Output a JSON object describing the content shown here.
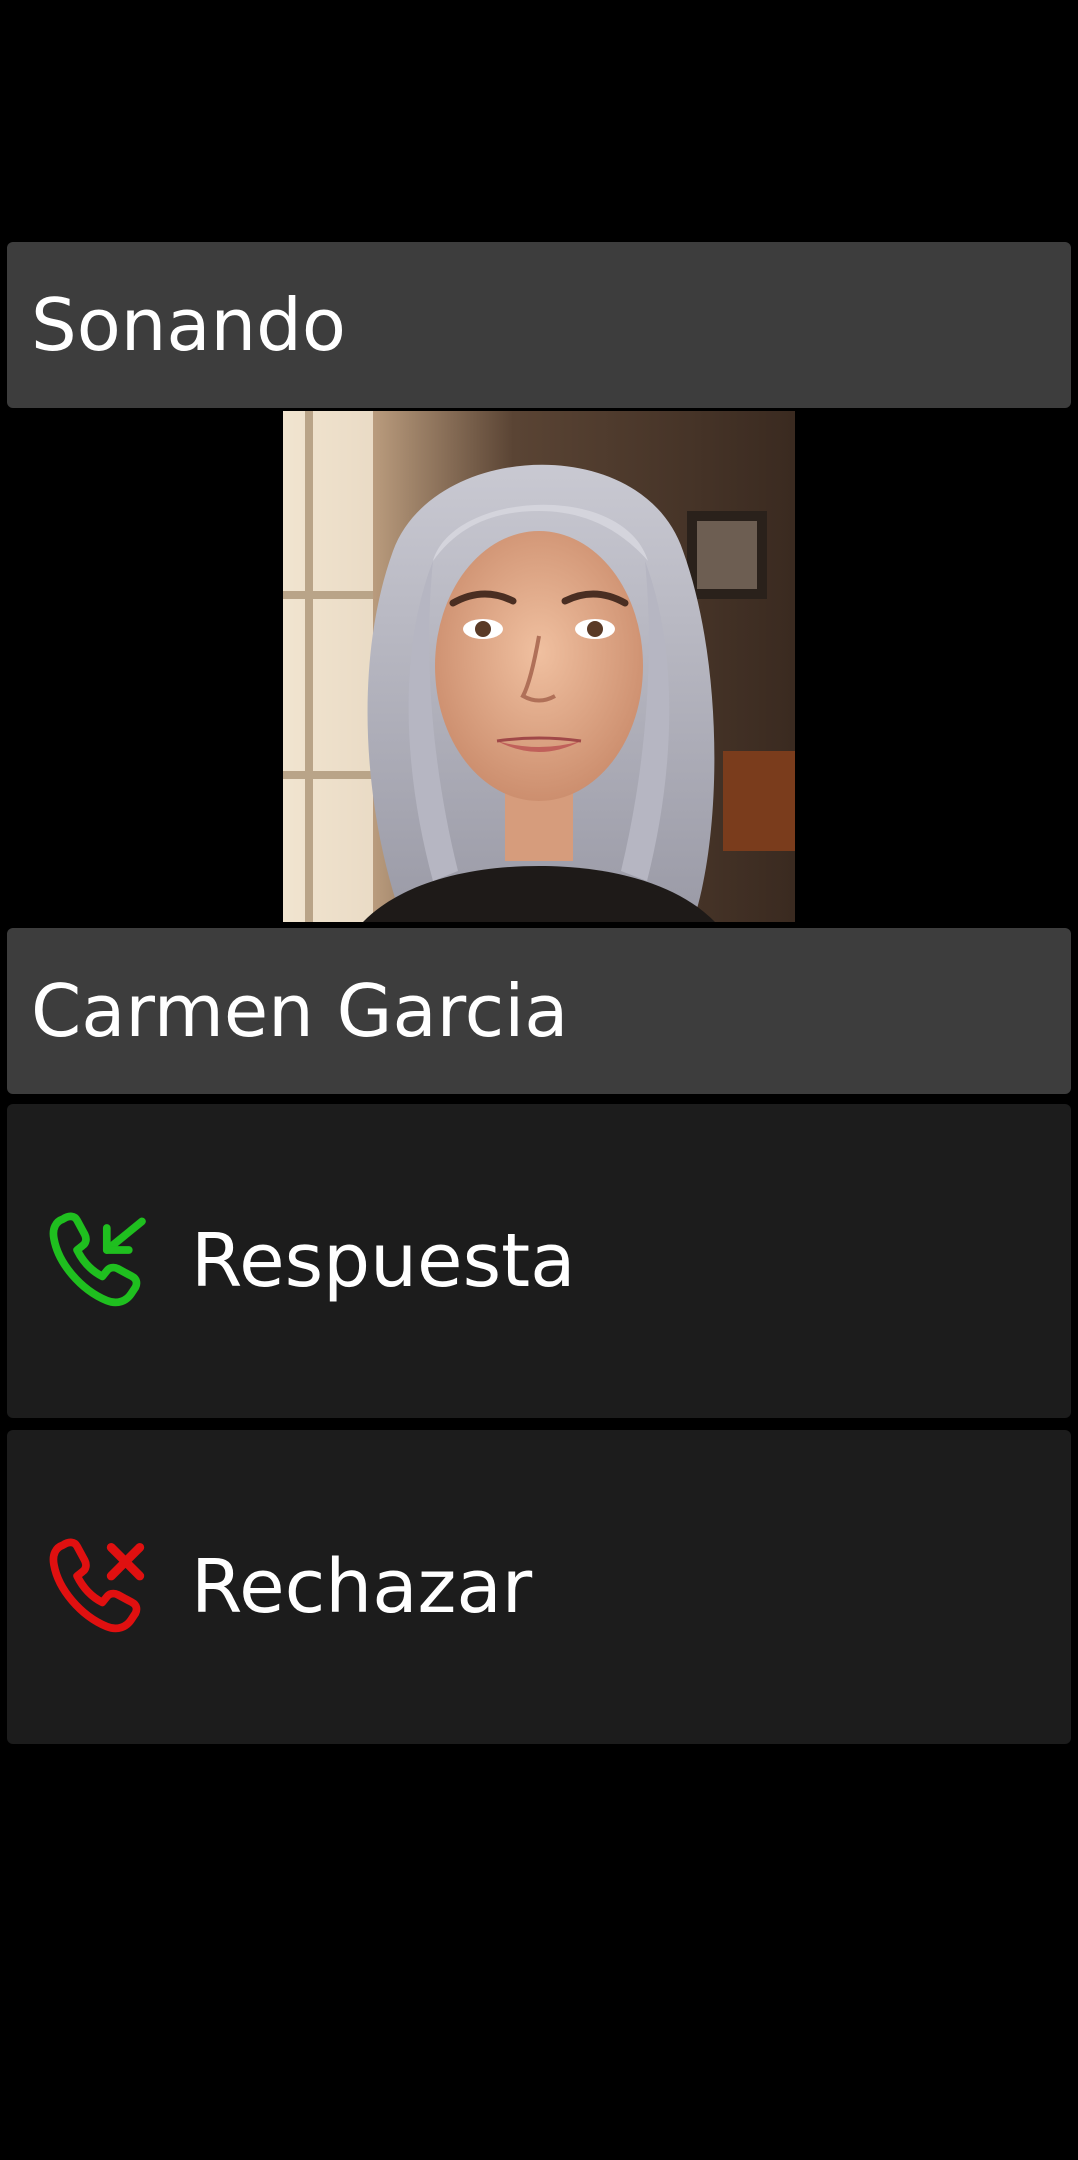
{
  "call": {
    "status": "Sonando",
    "caller_name": "Carmen Garcia",
    "photo_icon": "caller-photo"
  },
  "actions": {
    "answer": {
      "label": "Respuesta",
      "icon": "incoming-call-icon",
      "color": "#1fbf1f"
    },
    "reject": {
      "label": "Rechazar",
      "icon": "reject-call-icon",
      "color": "#e01010"
    }
  },
  "colors": {
    "background": "#000000",
    "bar": "#3d3d3d",
    "button": "#1c1c1c",
    "text": "#ffffff"
  }
}
